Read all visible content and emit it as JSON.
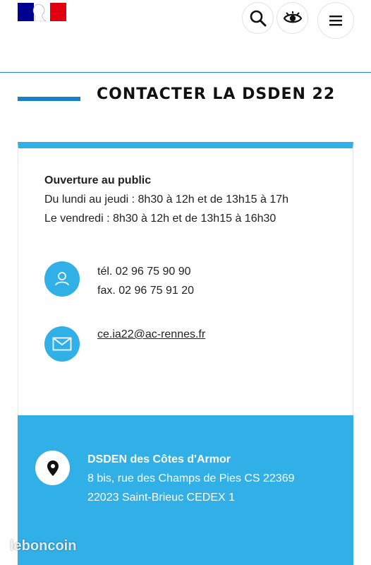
{
  "header": {
    "logo": "marianne-flag-logo",
    "icons": {
      "search": "search-icon",
      "accessibility": "eye-icon",
      "menu": "hamburger-menu-icon"
    }
  },
  "page_title": "CONTACTER LA DSDEN 22",
  "hours": {
    "title": "Ouverture au public",
    "line1": "Du lundi au jeudi : 8h30 à 12h et de 13h15 à 17h",
    "line2": "Le vendredi : 8h30 à 12h et de 13h15 à 16h30"
  },
  "phone": {
    "icon": "user-icon",
    "tel": "tél. 02 96 75 90 90",
    "fax": "fax. 02 96 75 91 20"
  },
  "email": {
    "icon": "mail-icon",
    "address": "ce.ia22@ac-rennes.fr"
  },
  "address": {
    "icon": "map-pin-icon",
    "name": "DSDEN des Côtes d'Armor",
    "street": "8 bis, rue des Champs de Pies  CS 22369",
    "city": "22023 Saint-Brieuc CEDEX 1"
  },
  "watermark": "leboncoin",
  "colors": {
    "accent": "#31b0e8",
    "title_bar": "#1a80c4",
    "flag_blue": "#000091",
    "flag_red": "#e1000f"
  }
}
